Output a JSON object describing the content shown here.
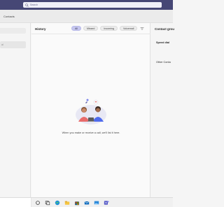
{
  "window": {
    "search_placeholder": "Search"
  },
  "subnav": {
    "tab_label": "Contacts"
  },
  "left_panel": {
    "input_placeholder": "al"
  },
  "history": {
    "title": "History",
    "filters": [
      {
        "label": "All",
        "active": true
      },
      {
        "label": "Missed",
        "active": false
      },
      {
        "label": "Incoming",
        "active": false
      },
      {
        "label": "Voicemail",
        "active": false
      }
    ],
    "empty_message": "When you make or receive a call, we'll list it here."
  },
  "right_panel": {
    "title": "Contact grou",
    "section1": "Speed dial",
    "section2": "Other Conta"
  },
  "taskbar": {
    "icons": [
      "search-icon",
      "task-view-icon",
      "edge-icon",
      "file-explorer-icon",
      "store-icon",
      "mail-icon",
      "photos-icon",
      "teams-icon"
    ]
  },
  "colors": {
    "titlebar": "#464775",
    "accent_pill": "#c5c6ef"
  }
}
